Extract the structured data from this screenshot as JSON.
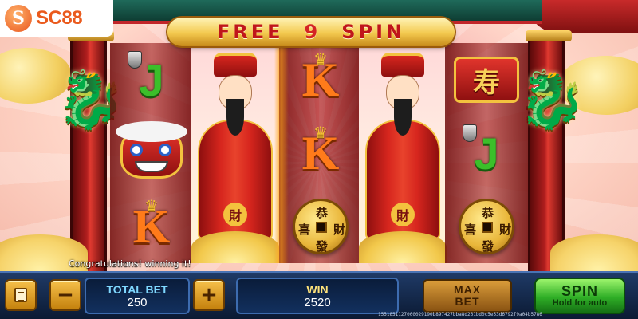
{
  "logo": {
    "mark": "S",
    "text": "SC88"
  },
  "banner": {
    "word1": "FREE",
    "count": "9",
    "word2": "SPIN"
  },
  "reels": {
    "reel1": {
      "top": "J",
      "bottom": "K"
    },
    "reel3": {
      "top": "K",
      "middle": "K",
      "coin_chars": [
        "恭",
        "喜",
        "財",
        "發"
      ]
    },
    "reel5": {
      "plaque": "寿",
      "middle": "J",
      "coin_chars": [
        "恭",
        "喜",
        "財",
        "發"
      ]
    },
    "fortune_emblem": "財"
  },
  "message": "Congratulations! winning it!",
  "bottom_bar": {
    "total_bet_label": "TOTAL BET",
    "total_bet_value": "250",
    "minus": "−",
    "plus": "+",
    "win_label": "WIN",
    "win_value": "2520",
    "max_label_1": "MAX",
    "max_label_2": "BET",
    "spin_label": "SPIN",
    "spin_sub": "Hold for auto",
    "round_id": "1551851127000029190b897427bba8d261bd0c5e53d6792f9a04b5786"
  },
  "colors": {
    "banner_text": "#c0161b",
    "symbol_j": "#3bbf2a",
    "symbol_k": "#ff7b1a",
    "spin_green": "#2fae26",
    "bar_blue": "#1f3a66"
  }
}
